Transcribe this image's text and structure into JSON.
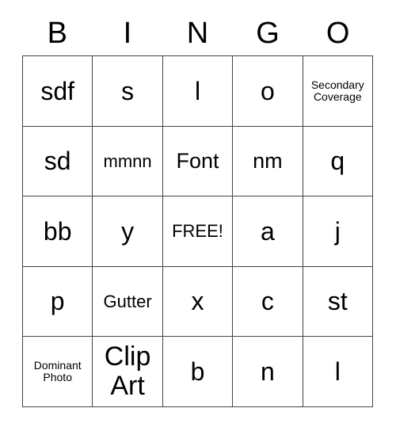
{
  "card": {
    "title_letters": [
      "B",
      "I",
      "N",
      "G",
      "O"
    ],
    "free_space_label": "FREE!",
    "border_color": "#444444",
    "text_color": "#000000",
    "background_color": "#ffffff",
    "rows": [
      [
        {
          "text": "sdf",
          "size": "lg"
        },
        {
          "text": "s",
          "size": "lg"
        },
        {
          "text": "l",
          "size": "lg"
        },
        {
          "text": "o",
          "size": "lg"
        },
        {
          "text": "Secondary\nCoverage",
          "size": "xs"
        }
      ],
      [
        {
          "text": "sd",
          "size": "lg"
        },
        {
          "text": "mmnn",
          "size": "sm"
        },
        {
          "text": "Font",
          "size": "md"
        },
        {
          "text": "nm",
          "size": "md"
        },
        {
          "text": "q",
          "size": "lg"
        }
      ],
      [
        {
          "text": "bb",
          "size": "lg"
        },
        {
          "text": "y",
          "size": "lg"
        },
        {
          "text": "FREE!",
          "size": "sm"
        },
        {
          "text": "a",
          "size": "lg"
        },
        {
          "text": "j",
          "size": "lg"
        }
      ],
      [
        {
          "text": "p",
          "size": "lg"
        },
        {
          "text": "Gutter",
          "size": "sm"
        },
        {
          "text": "x",
          "size": "lg"
        },
        {
          "text": "c",
          "size": "lg"
        },
        {
          "text": "st",
          "size": "lg"
        }
      ],
      [
        {
          "text": "Dominant\nPhoto",
          "size": "xs"
        },
        {
          "text": "Clip\nArt",
          "size": "xl"
        },
        {
          "text": "b",
          "size": "lg"
        },
        {
          "text": "n",
          "size": "lg"
        },
        {
          "text": "l",
          "size": "lg"
        }
      ]
    ]
  }
}
